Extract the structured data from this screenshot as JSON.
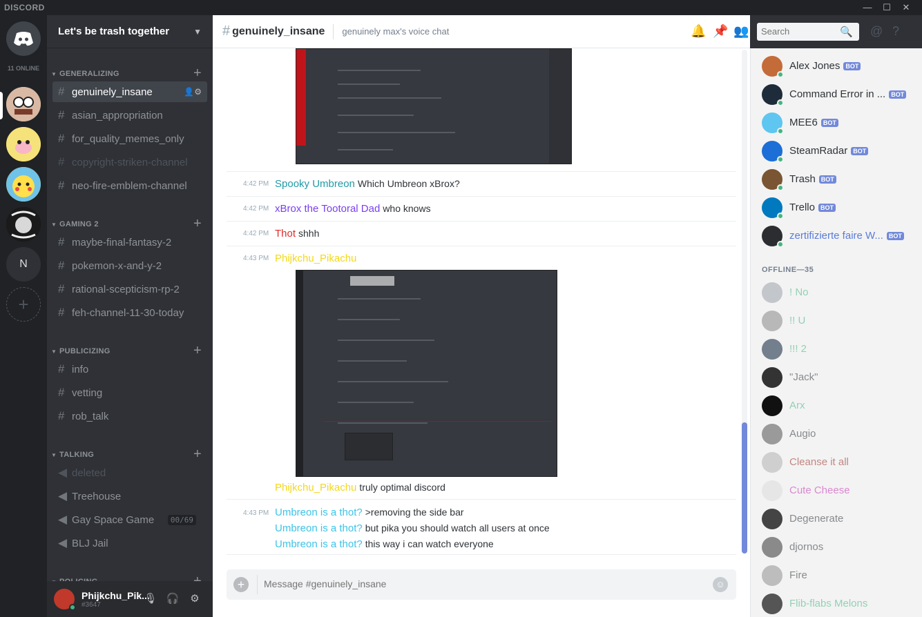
{
  "app": {
    "brand": "DISCORD"
  },
  "window_controls": {
    "minimize": "—",
    "maximize": "☐",
    "close": "✕"
  },
  "rail": {
    "online_count": "11 ONLINE",
    "letter_server": "N",
    "add_server": "+"
  },
  "guild": {
    "name": "Let's be trash together"
  },
  "categories": {
    "generalizing": "GENERALIZING",
    "gaming2": "GAMING 2",
    "publicizing": "PUBLICIZING",
    "talking": "TALKING",
    "policing": "POLICING"
  },
  "channels": {
    "generalizing": [
      "genuinely_insane",
      "asian_appropriation",
      "for_quality_memes_only",
      "copyright-striken-channel",
      "neo-fire-emblem-channel"
    ],
    "gaming2": [
      "maybe-final-fantasy-2",
      "pokemon-x-and-y-2",
      "rational-scepticism-rp-2",
      "feh-channel-11-30-today"
    ],
    "publicizing": [
      "info",
      "vetting",
      "rob_talk"
    ],
    "talking": [
      "deleted",
      "Treehouse",
      "Gay Space Game",
      "BLJ Jail"
    ],
    "voice_count": "00/69"
  },
  "user": {
    "name": "Phijkchu_Pik...",
    "discriminator": "#3647"
  },
  "header": {
    "channel": "genuinely_insane",
    "topic": "genuinely max's voice chat",
    "search_placeholder": "Search"
  },
  "messages": [
    {
      "time": "4:42 PM",
      "author": "Spooky Umbreon",
      "color": "#1f9aa6",
      "text": "Which Umbreon xBrox?"
    },
    {
      "time": "4:42 PM",
      "author": "xBrox the Tootoral Dad",
      "color": "#7a3ff0",
      "text": "who knows"
    },
    {
      "time": "4:42 PM",
      "author": "Thot",
      "color": "#e02a2a",
      "text": "shhh"
    },
    {
      "time": "4:43 PM",
      "author": "Phijkchu_Pikachu",
      "color": "#f4d81b",
      "text": ""
    },
    {
      "time": "",
      "author": "Phijkchu_Pikachu",
      "color": "#f4d81b",
      "text": "truly optimal discord"
    },
    {
      "time": "4:43 PM",
      "author": "Umbreon is a thot?",
      "color": "#3cc4e8",
      "text": ">removing the side bar"
    },
    {
      "time": "",
      "author": "Umbreon is a thot?",
      "color": "#3cc4e8",
      "text": "but pika you should watch all users at once"
    },
    {
      "time": "",
      "author": "Umbreon is a thot?",
      "color": "#3cc4e8",
      "text": "this way i can watch everyone"
    }
  ],
  "composer": {
    "placeholder": "Message #genuinely_insane"
  },
  "members": {
    "bot_label": "BOT",
    "online": [
      {
        "name": "Alex Jones",
        "bot": true,
        "color": "#2e3338"
      },
      {
        "name": "Command Error in ...",
        "bot": true,
        "color": "#2e3338"
      },
      {
        "name": "MEE6",
        "bot": true,
        "color": "#2e3338"
      },
      {
        "name": "SteamRadar",
        "bot": true,
        "color": "#2e3338"
      },
      {
        "name": "Trash",
        "bot": true,
        "color": "#2e3338"
      },
      {
        "name": "Trello",
        "bot": true,
        "color": "#2e3338"
      },
      {
        "name": "zertifizierte faire W...",
        "bot": true,
        "color": "#5b7bd9"
      }
    ],
    "offline_header": "OFFLINE—35",
    "offline": [
      {
        "name": "! No",
        "color": "#43b581"
      },
      {
        "name": "!! U",
        "color": "#43b581"
      },
      {
        "name": "!!! 2",
        "color": "#43b581"
      },
      {
        "name": "\"Jack\"",
        "color": "#2e3338"
      },
      {
        "name": "Arx",
        "color": "#43b581"
      },
      {
        "name": "Augio",
        "color": "#2e3338"
      },
      {
        "name": "Cleanse it all",
        "color": "#992d22"
      },
      {
        "name": "Cute Cheese",
        "color": "#c730b4"
      },
      {
        "name": "Degenerate",
        "color": "#2e3338"
      },
      {
        "name": "djornos",
        "color": "#2e3338"
      },
      {
        "name": "Fire",
        "color": "#2e3338"
      },
      {
        "name": "Flib-flabs Melons",
        "color": "#43b581"
      }
    ]
  }
}
